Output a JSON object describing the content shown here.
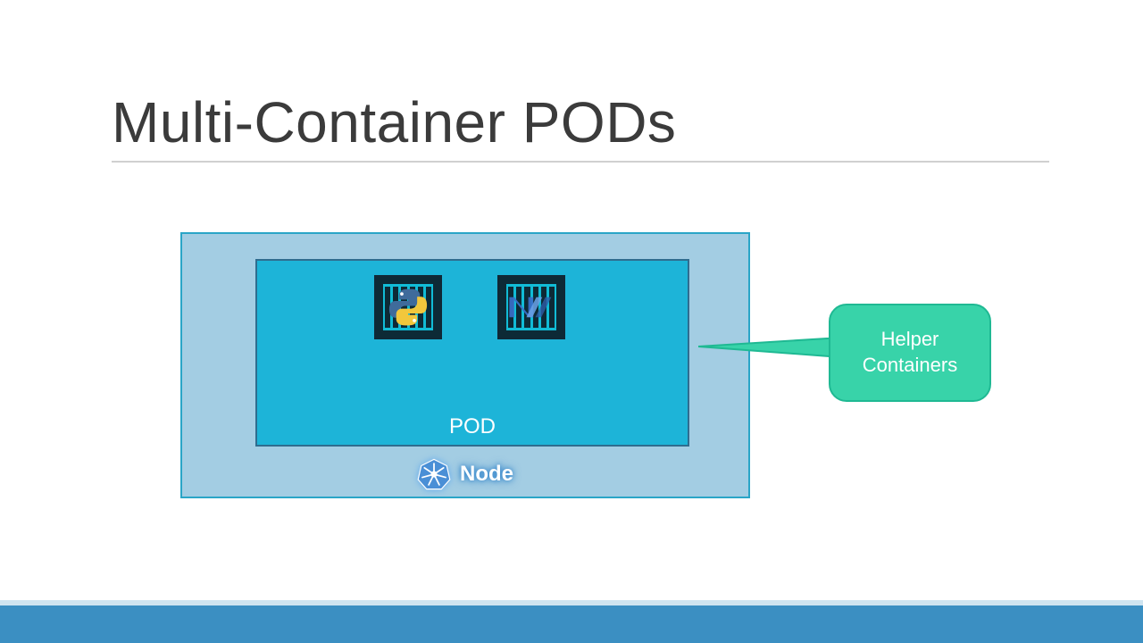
{
  "title": "Multi-Container PODs",
  "node": {
    "label": "Node"
  },
  "pod": {
    "label": "POD",
    "containers": [
      {
        "name": "python",
        "icon": "python"
      },
      {
        "name": "dotnet",
        "icon": "dotnet"
      }
    ]
  },
  "callout": {
    "line1": "Helper",
    "line2": "Containers"
  },
  "colors": {
    "nodeFill": "#a3cde3",
    "podFill": "#1db4d8",
    "calloutFill": "#38d3a9",
    "bottomBar": "#3b8fc2"
  }
}
